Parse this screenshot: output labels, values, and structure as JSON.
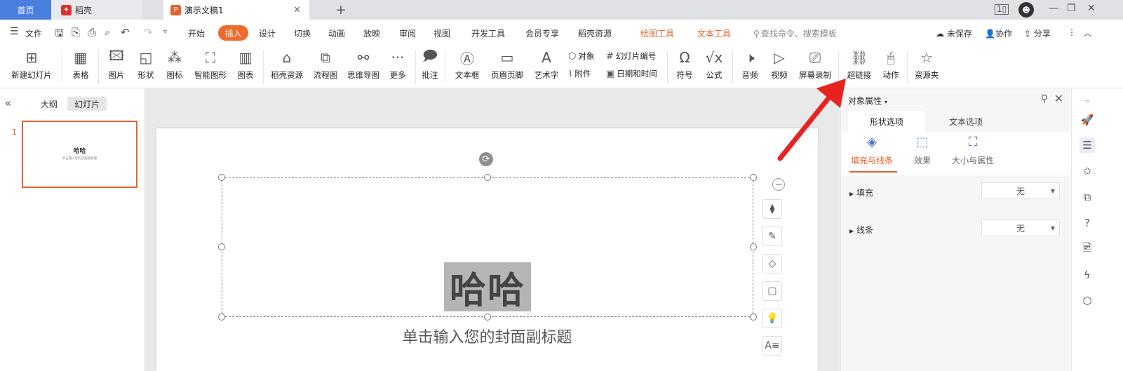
{
  "tabs": {
    "home": "首页",
    "daoke": "稻壳",
    "doc": "演示文稿1",
    "doc_close": "✕",
    "new_tab": "+"
  },
  "window": {
    "min": "—",
    "restore": "❐",
    "close": "✕"
  },
  "menu": {
    "file": "文件",
    "items": [
      "开始",
      "插入",
      "设计",
      "切换",
      "动画",
      "放映",
      "审阅",
      "视图",
      "开发工具",
      "会员专享",
      "稻壳资源"
    ],
    "drawing_tools": "绘图工具",
    "text_tools": "文本工具",
    "search_placeholder": "查找命令、搜索模板",
    "unsaved": "未保存",
    "collab": "协作",
    "share": "分享"
  },
  "ribbon": {
    "new_slide": "新建幻灯片",
    "table": "表格",
    "picture": "图片",
    "shape": "形状",
    "icon": "图标",
    "smart_art": "智能图形",
    "chart": "图表",
    "daoke_res": "稻壳资源",
    "flowchart": "流程图",
    "mindmap": "思维导图",
    "more": "更多",
    "comment": "批注",
    "textbox": "文本框",
    "header_footer": "页眉页脚",
    "wordart": "艺术字",
    "object": "对象",
    "slide_number": "幻灯片编号",
    "attachment": "附件",
    "datetime": "日期和时间",
    "symbol": "符号",
    "formula": "公式",
    "audio": "音频",
    "video": "视频",
    "screen_record": "屏幕录制",
    "hyperlink": "超链接",
    "action": "动作",
    "resource_folder": "资源夹"
  },
  "left_panel": {
    "outline": "大纲",
    "slides": "幻灯片",
    "slide_number": "1",
    "thumb_title": "哈哈",
    "thumb_subtitle": "单击输入您的封面副标题"
  },
  "slide": {
    "title": "哈哈",
    "subtitle": "单击输入您的封面副标题"
  },
  "properties": {
    "title": "对象属性",
    "shape_options": "形状选项",
    "text_options": "文本选项",
    "fill_line": "填充与线条",
    "effects": "效果",
    "size_props": "大小与属性",
    "fill": "填充",
    "fill_value": "无",
    "line": "线条",
    "line_value": "无"
  },
  "colors": {
    "accent": "#f1692c",
    "tab_home": "#4a7fe0",
    "arrow": "#e8231f"
  }
}
